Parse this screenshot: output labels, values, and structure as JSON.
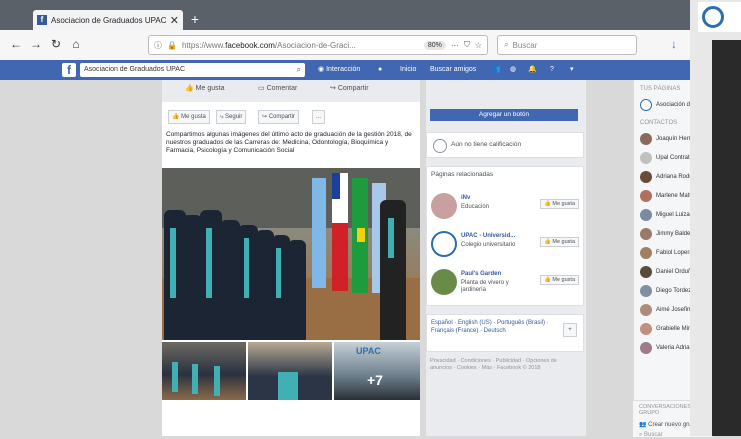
{
  "browser": {
    "tab_title": "Asociacion de Graduados UPAC",
    "favicon": "f",
    "new_tab": "+",
    "close": "✕",
    "url_prefix": "https://www.",
    "url_domain": "facebook.com",
    "url_path": "/Asociacion-de-Graci...",
    "zoom": "80%",
    "search_placeholder": "Buscar"
  },
  "fb": {
    "logo": "f",
    "search_value": "Asociacion de Graduados UPAC",
    "nav": [
      "Interacción",
      "Inicio",
      "Buscar amigos"
    ]
  },
  "cover_links": [
    "Me gusta",
    "Comentar",
    "Compartir"
  ],
  "actions": [
    "Me gusta",
    "Seguir",
    "Compartir",
    "..."
  ],
  "post_text": "Compartimos algunas imágenes del último acto de graduación de la gestión 2018, de nuestros graduados de las Carreras de: Medicina, Odontología, Bioquímica y Farmacia, Psicología y Comunicación Social",
  "photos": {
    "more_count": "+7",
    "thumb_logo": "UPAC"
  },
  "recommend_button": "Agregar un botón",
  "rating_text": "Aún no tiene calificación",
  "pages_card": {
    "title": "Páginas relacionadas",
    "pages": [
      {
        "name": "iNv",
        "sub": "Educación",
        "like": "Me gusta"
      },
      {
        "name": "UPAC - Universid...",
        "sub": "Colegio universitario",
        "like": "Me gusta"
      },
      {
        "name": "Paul's Garden",
        "sub": "Planta de vivero y jardinería",
        "like": "Me gusta"
      }
    ]
  },
  "languages": "Español · English (US) · Português (Brasil) · Français (France) · Deutsch",
  "lang_plus": "+",
  "footer": "Privacidad · Condiciones · Publicidad · Opciones de anuncios · Cookies · Más · Facebook © 2018",
  "sidebar": {
    "pages_header": "TUS PÁGINAS",
    "page_item": "Asociación de...",
    "contacts_header": "CONTACTOS",
    "contacts": [
      "Joaquín Herre",
      "Upal Contratos",
      "Adriana Rodrad",
      "Marlene Mattos",
      "Miguel Luizaga",
      "Jimmy Balderr",
      "Fabiol Lopera",
      "Daniel Orduños",
      "Diego Tordez M.",
      "Aimé Josefina",
      "Grabielle Mingor",
      "Valeria Adriana Bri..."
    ],
    "group_header": "CONVERSACIONES EN GRUPO",
    "new_group": "Crear nuevo grupo",
    "search_placeholder": "Buscar"
  },
  "colors": {
    "fb_blue": "#4267b2",
    "chrome": "#5a6168",
    "stole": "#40b0b4"
  }
}
